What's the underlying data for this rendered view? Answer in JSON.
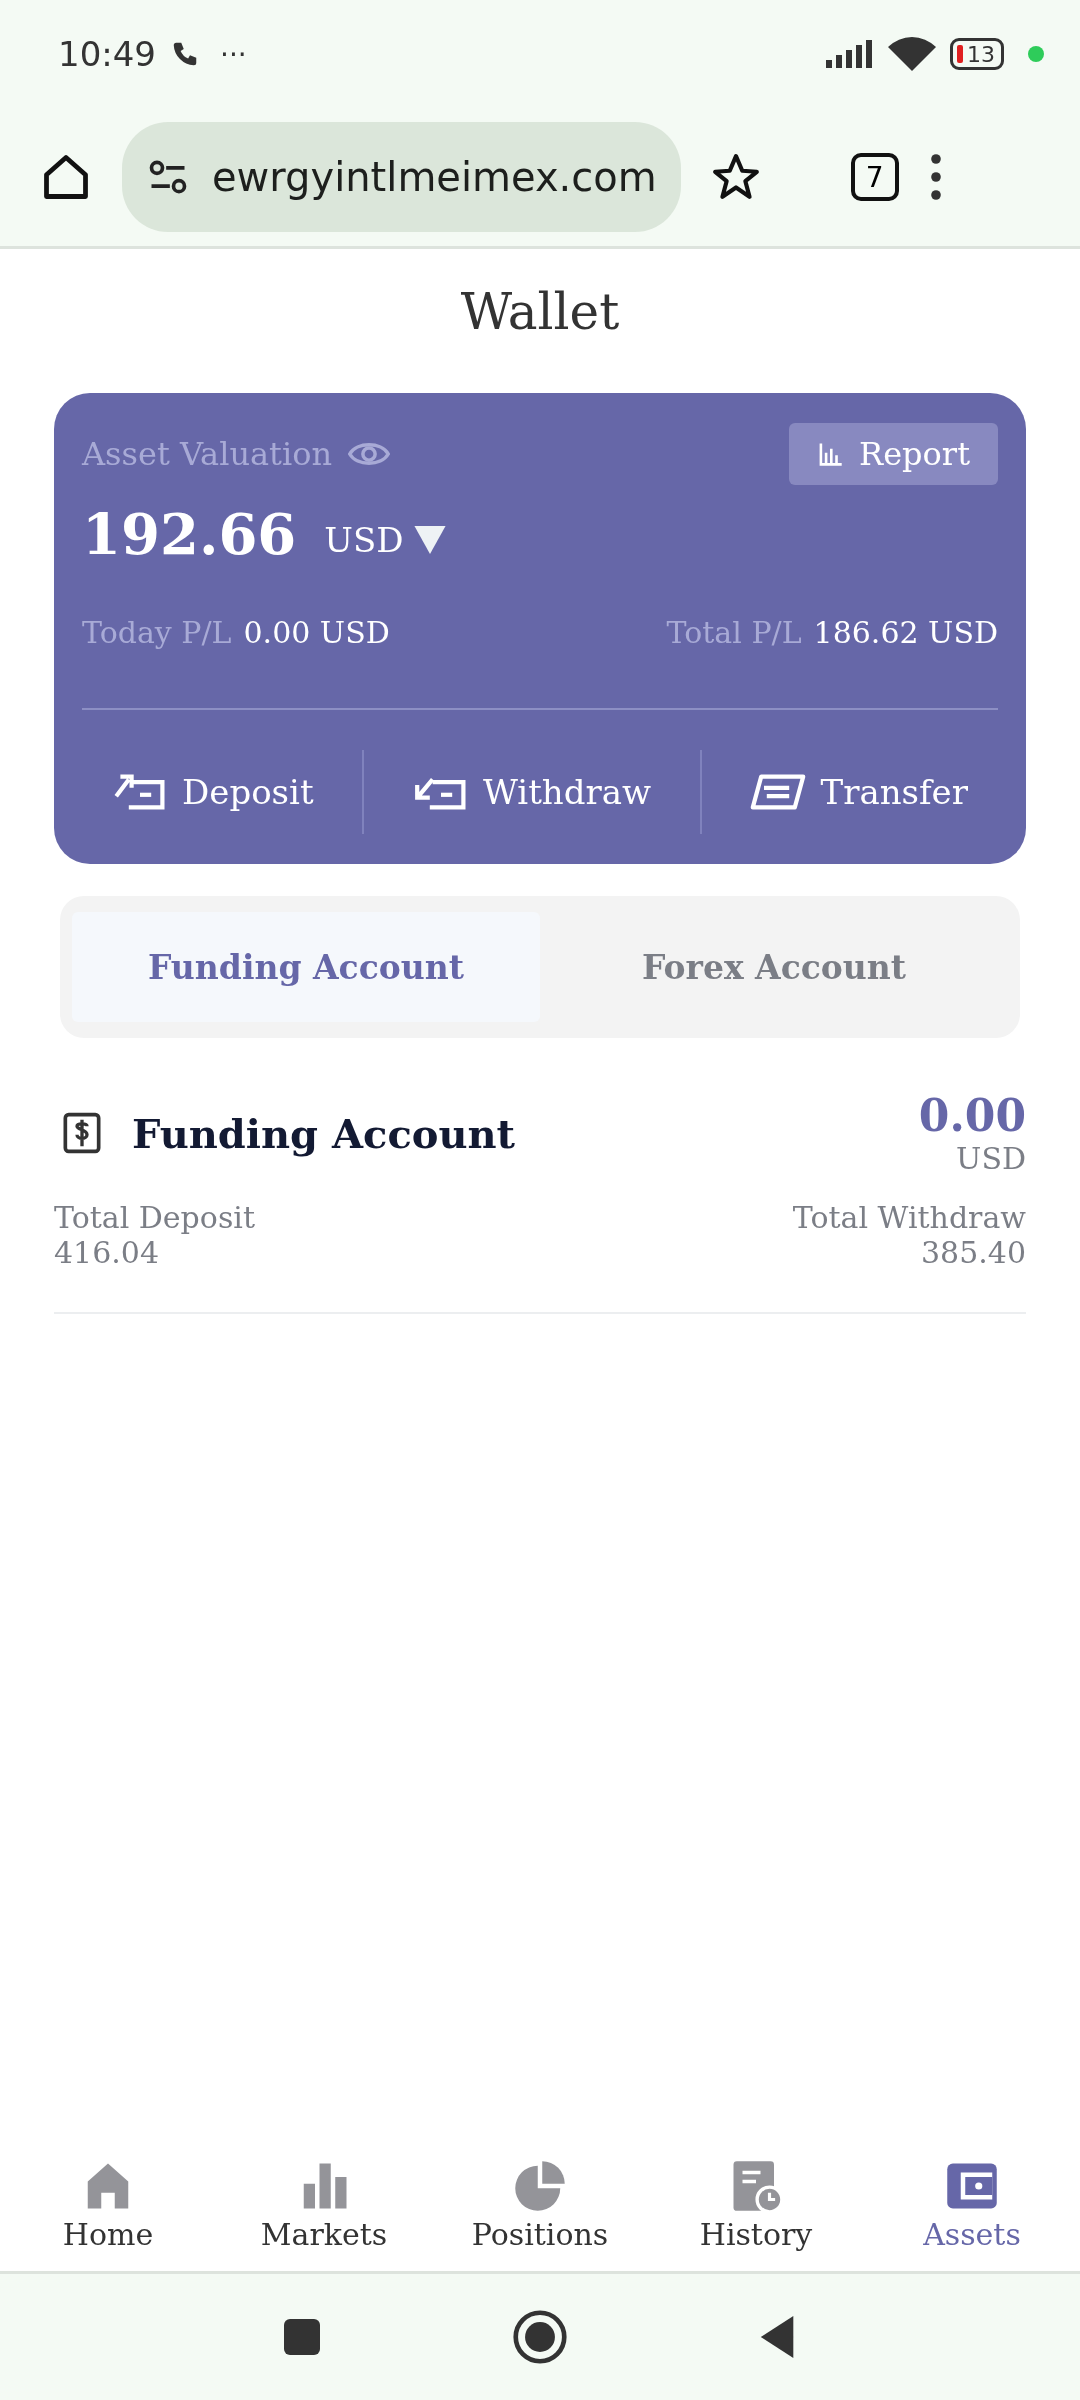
{
  "status_bar": {
    "time": "10:49",
    "more": "···",
    "battery": "13"
  },
  "browser": {
    "url": "ewrgyintlmeimex.com",
    "tab_count": "7"
  },
  "page_title": "Wallet",
  "asset_card": {
    "label": "Asset Valuation",
    "report_button": "Report",
    "amount": "192.66",
    "currency": "USD",
    "today_label": "Today P/L",
    "today_value": "0.00 USD",
    "total_label": "Total P/L",
    "total_value": "186.62 USD",
    "actions": [
      {
        "kind": "deposit",
        "label": "Deposit"
      },
      {
        "kind": "withdraw",
        "label": "Withdraw"
      },
      {
        "kind": "transfer",
        "label": "Transfer"
      }
    ]
  },
  "account_tabs": [
    {
      "label": "Funding Account",
      "selected": true
    },
    {
      "label": "Forex Account",
      "selected": false
    }
  ],
  "account": {
    "title": "Funding Account",
    "balance": "0.00",
    "currency": "USD",
    "deposit_label": "Total Deposit",
    "deposit_value": "416.04",
    "withdraw_label": "Total Withdraw",
    "withdraw_value": "385.40"
  },
  "bottom_nav": [
    {
      "kind": "home",
      "label": "Home",
      "selected": false
    },
    {
      "kind": "markets",
      "label": "Markets",
      "selected": false
    },
    {
      "kind": "positions",
      "label": "Positions",
      "selected": false
    },
    {
      "kind": "history",
      "label": "History",
      "selected": false
    },
    {
      "kind": "assets",
      "label": "Assets",
      "selected": true
    }
  ]
}
